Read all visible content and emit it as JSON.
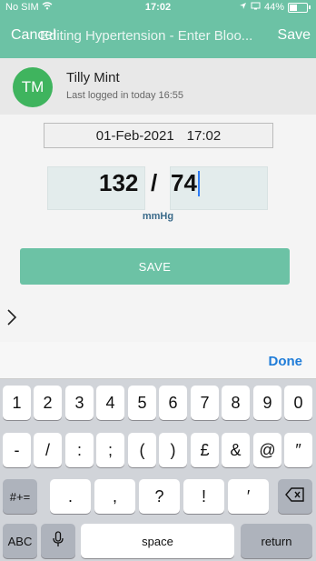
{
  "status": {
    "carrier": "No SIM",
    "time": "17:02",
    "battery": "44%"
  },
  "nav": {
    "cancel": "Cancel",
    "title": "Editing Hypertension - Enter Bloo...",
    "save": "Save"
  },
  "profile": {
    "initials": "TM",
    "name": "Tilly Mint",
    "last_logged": "Last logged in today 16:55"
  },
  "reading": {
    "date": "01-Feb-2021",
    "time": "17:02",
    "systolic": "132",
    "separator": "/",
    "diastolic": "74",
    "unit": "mmHg"
  },
  "form": {
    "save_button": "SAVE"
  },
  "keyboard": {
    "done": "Done",
    "row1": [
      "1",
      "2",
      "3",
      "4",
      "5",
      "6",
      "7",
      "8",
      "9",
      "0"
    ],
    "row2": [
      "-",
      "/",
      ":",
      ";",
      "(",
      ")",
      "£",
      "&",
      "@",
      "″"
    ],
    "row3": [
      ".",
      ",",
      "?",
      "!",
      "′"
    ],
    "shift_label": "#+=",
    "abc": "ABC",
    "space": "space",
    "return": "return"
  },
  "colors": {
    "accent": "#6cc2a5",
    "avatar": "#3fb45e",
    "link": "#1f7cd8"
  }
}
